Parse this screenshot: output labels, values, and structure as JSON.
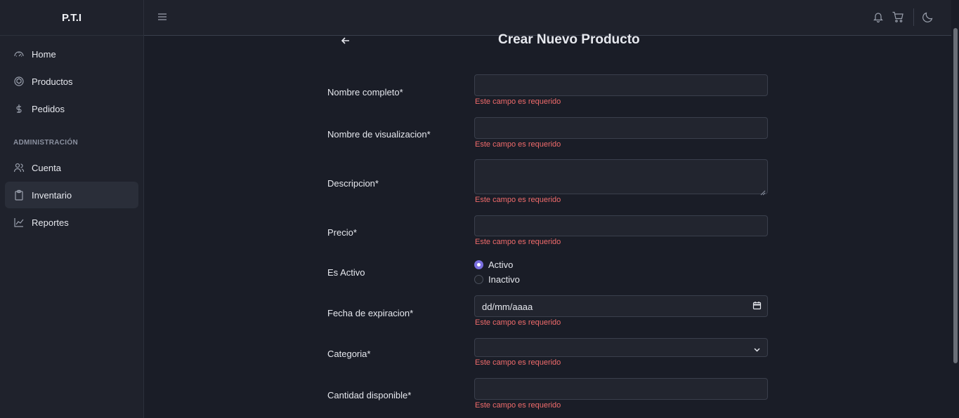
{
  "app": {
    "brand": "P.T.I"
  },
  "sidebar": {
    "items": [
      {
        "label": "Home",
        "icon": "dashboard-icon"
      },
      {
        "label": "Productos",
        "icon": "box-icon"
      },
      {
        "label": "Pedidos",
        "icon": "dollar-icon"
      }
    ],
    "section_title": "ADMINISTRACIÓN",
    "admin_items": [
      {
        "label": "Cuenta",
        "icon": "users-icon"
      },
      {
        "label": "Inventario",
        "icon": "clipboard-icon",
        "active": true
      },
      {
        "label": "Reportes",
        "icon": "chart-line-icon"
      }
    ]
  },
  "page": {
    "title": "Crear Nuevo Producto"
  },
  "form": {
    "nombre_completo": {
      "label": "Nombre completo*",
      "value": "",
      "error": "Este campo es requerido"
    },
    "nombre_visualizacion": {
      "label": "Nombre de visualizacion*",
      "value": "",
      "error": "Este campo es requerido"
    },
    "descripcion": {
      "label": "Descripcion*",
      "value": "",
      "error": "Este campo es requerido"
    },
    "precio": {
      "label": "Precio*",
      "value": "",
      "error": "Este campo es requerido"
    },
    "es_activo": {
      "label": "Es Activo",
      "options": [
        "Activo",
        "Inactivo"
      ],
      "selected": "Activo"
    },
    "fecha_expiracion": {
      "label": "Fecha de expiracion*",
      "placeholder": "dd/mm/aaaa",
      "error": "Este campo es requerido"
    },
    "categoria": {
      "label": "Categoria*",
      "value": "",
      "error": "Este campo es requerido"
    },
    "cantidad": {
      "label": "Cantidad disponible*",
      "value": "",
      "error": "Este campo es requerido"
    }
  },
  "colors": {
    "accent": "#7a6fe0",
    "error": "#f06b6b",
    "background": "#1a1d27",
    "panel": "#1f222c"
  }
}
